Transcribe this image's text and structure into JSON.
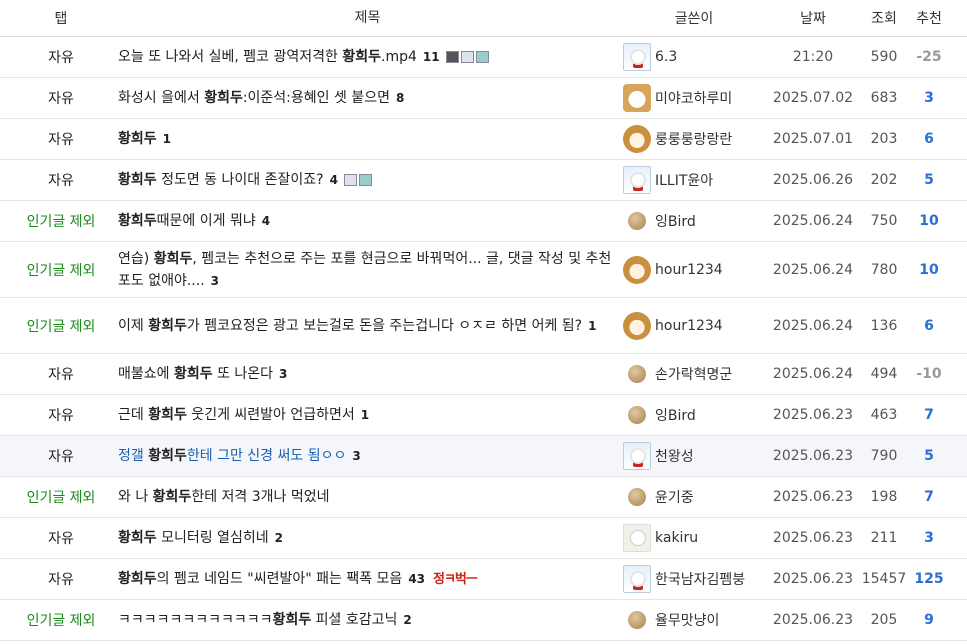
{
  "headers": {
    "tab": "탭",
    "title": "제목",
    "author": "글쓴이",
    "date": "날짜",
    "views": "조회",
    "rec": "추천"
  },
  "rows": [
    {
      "tab": "자유",
      "pre": "오늘 또 나와서 실베, 펨코 광역저격한 ",
      "bold": "황희두",
      "post": ".mp4",
      "comments": "11",
      "author": "6.3",
      "date": "21:20",
      "views": "590",
      "rec": "-25"
    },
    {
      "tab": "자유",
      "pre": "화성시 을에서 ",
      "bold": "황희두",
      "post": ":이준석:용혜인 셋 붙으면",
      "comments": "8",
      "author": "미야코하루미",
      "date": "2025.07.02",
      "views": "683",
      "rec": "3"
    },
    {
      "tab": "자유",
      "pre": "",
      "bold": "황희두",
      "post": "",
      "comments": "1",
      "author": "룽룽룽랑랑란",
      "date": "2025.07.01",
      "views": "203",
      "rec": "6"
    },
    {
      "tab": "자유",
      "pre": "",
      "bold": "황희두",
      "post": " 정도면 동 나이대 존잘이죠?",
      "comments": "4",
      "author": "ILLIT윤아",
      "date": "2025.06.26",
      "views": "202",
      "rec": "5"
    },
    {
      "tab": "인기글 제외",
      "pre": "",
      "bold": "황희두",
      "post": "때문에 이게 뭐냐",
      "comments": "4",
      "author": "잉Bird",
      "date": "2025.06.24",
      "views": "750",
      "rec": "10"
    },
    {
      "tab": "인기글 제외",
      "pre": "연습) ",
      "bold": "황희두",
      "post": ", 펨코는 추천으로 주는 포를 현금으로 바꿔먹어... 글, 댓글 작성 및 추천포도 없애야....",
      "comments": "3",
      "author": "hour1234",
      "date": "2025.06.24",
      "views": "780",
      "rec": "10"
    },
    {
      "tab": "인기글 제외",
      "pre": "이제 ",
      "bold": "황희두",
      "post": "가 펨코요정은 광고 보는걸로 돈을 주는겁니다 ㅇㅈㄹ 하면 어케 됨?",
      "comments": "1",
      "author": "hour1234",
      "date": "2025.06.24",
      "views": "136",
      "rec": "6"
    },
    {
      "tab": "자유",
      "pre": "매불쇼에 ",
      "bold": "황희두",
      "post": " 또 나온다",
      "comments": "3",
      "author": "손가락혁명군",
      "date": "2025.06.24",
      "views": "494",
      "rec": "-10"
    },
    {
      "tab": "자유",
      "pre": "근데 ",
      "bold": "황희두",
      "post": " 웃긴게 씨련발아 언급하면서",
      "comments": "1",
      "author": "잉Bird",
      "date": "2025.06.23",
      "views": "463",
      "rec": "7"
    },
    {
      "tab": "자유",
      "pre": "정갤 ",
      "bold": "황희두",
      "post": "한테 그만 신경 써도 됨ㅇㅇ",
      "comments": "3",
      "author": "천왕성",
      "date": "2025.06.23",
      "views": "790",
      "rec": "5"
    },
    {
      "tab": "인기글 제외",
      "pre": "와 나 ",
      "bold": "황희두",
      "post": "한테 저격 3개나 먹었네",
      "comments": "",
      "author": "윤기중",
      "date": "2025.06.23",
      "views": "198",
      "rec": "7"
    },
    {
      "tab": "자유",
      "pre": "",
      "bold": "황희두",
      "post": " 모니터링 열심히네",
      "comments": "2",
      "author": "kakiru",
      "date": "2025.06.23",
      "views": "211",
      "rec": "3"
    },
    {
      "tab": "자유",
      "pre": "",
      "bold": "황희두",
      "post": "의 펨코 네임드 \"씨련발아\" 패는 팩폭 모음",
      "comments": "43",
      "badge": "정ㅋ벅ㅡ",
      "author": "한국남자김펨붕",
      "date": "2025.06.23",
      "views": "15457",
      "rec": "125"
    },
    {
      "tab": "인기글 제외",
      "pre": "ㅋㅋㅋㅋㅋㅋㅋㅋㅋㅋㅋㅋ",
      "bold": "황희두",
      "post": " 피셜 호감고닉",
      "comments": "2",
      "author": "율무맛냥이",
      "date": "2025.06.23",
      "views": "205",
      "rec": "9"
    }
  ]
}
